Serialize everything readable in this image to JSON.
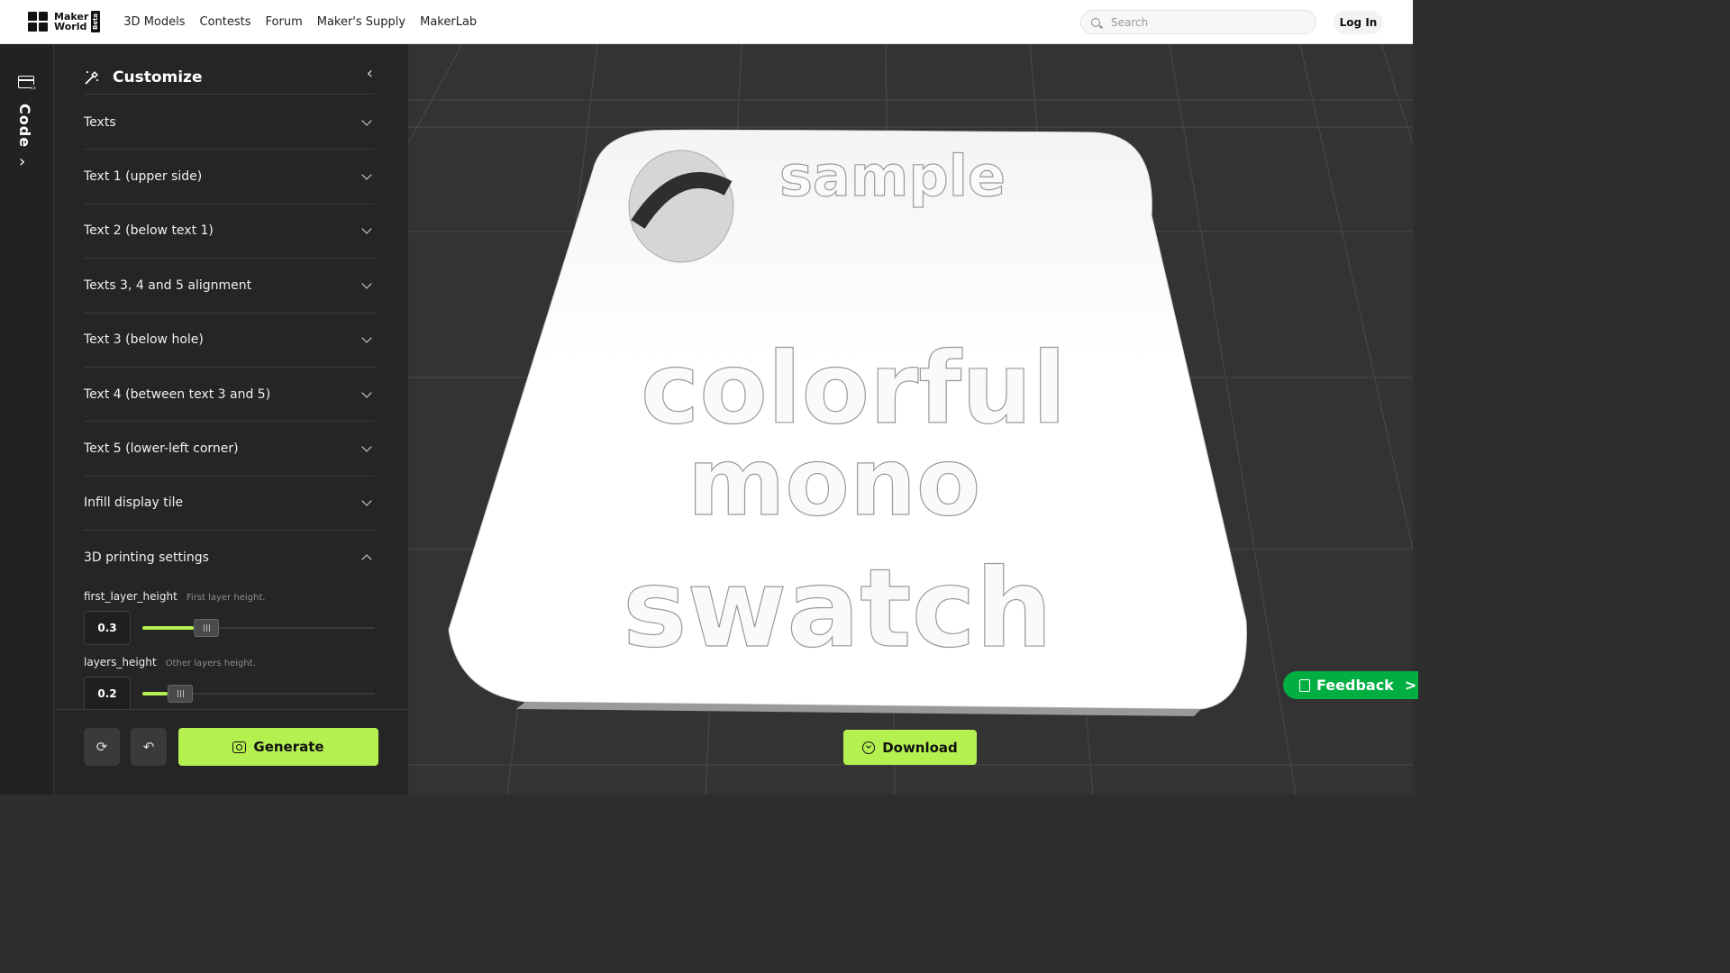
{
  "header": {
    "logo_line1": "Maker",
    "logo_line2": "World",
    "beta_badge": "Beta",
    "nav": [
      "3D Models",
      "Contests",
      "Forum",
      "Maker's Supply",
      "MakerLab"
    ],
    "search_placeholder": "Search",
    "login_label": "Log In"
  },
  "rail": {
    "code_label": "Code"
  },
  "panel": {
    "title": "Customize",
    "sections": [
      {
        "label": "Texts",
        "open": false
      },
      {
        "label": "Text 1 (upper side)",
        "open": false
      },
      {
        "label": "Text 2 (below text 1)",
        "open": false
      },
      {
        "label": "Texts 3, 4 and 5 alignment",
        "open": false
      },
      {
        "label": "Text 3 (below hole)",
        "open": false
      },
      {
        "label": "Text 4 (between text 3 and 5)",
        "open": false
      },
      {
        "label": "Text 5 (lower-left corner)",
        "open": false
      },
      {
        "label": "Infill display tile",
        "open": false
      },
      {
        "label": "3D printing settings",
        "open": true
      }
    ],
    "params": [
      {
        "name": "first_layer_height",
        "hint": "First layer height.",
        "value": "0.3",
        "level": 0.22
      },
      {
        "name": "layers_height",
        "hint": "Other layers height.",
        "value": "0.2",
        "level": 0.11
      }
    ],
    "generate_label": "Generate"
  },
  "viewport": {
    "model_texts": [
      "sample",
      "colorful",
      "mono",
      "swatch"
    ],
    "download_label": "Download"
  },
  "feedback": {
    "label": "Feedback",
    "arrow": ">"
  },
  "colors": {
    "accent": "#b5f051",
    "feedback": "#00ae42",
    "panel_bg": "#252525",
    "viewport_bg": "#333333"
  }
}
